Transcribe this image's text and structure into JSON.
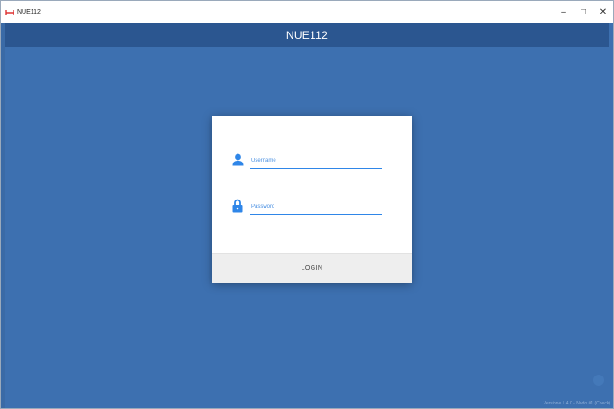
{
  "window": {
    "title": "NUE112",
    "minimize_glyph": "–",
    "maximize_glyph": "□",
    "close_glyph": "✕"
  },
  "header": {
    "title": "NUE112"
  },
  "login": {
    "username_placeholder": "Username",
    "username_value": "",
    "password_placeholder": "Password",
    "password_value": "",
    "button_label": "LOGIN",
    "username_icon": "person-icon",
    "password_icon": "lock-icon"
  },
  "footer": {
    "version": "Versione 1.4.0 - Nodo #1 (Check)"
  },
  "colors": {
    "background": "#3d70b0",
    "header": "#2b5690",
    "accent": "#2f86e8",
    "button_bg": "#eeeeee"
  }
}
